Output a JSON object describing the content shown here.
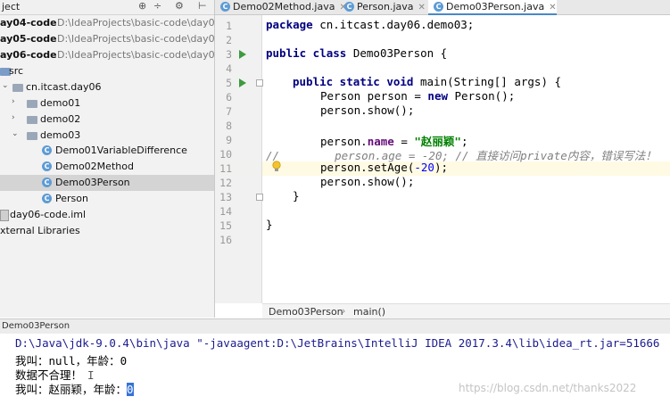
{
  "project": {
    "header_title": "ject",
    "icons": [
      "target-icon",
      "split-icon",
      "gear-icon",
      "hide-icon"
    ],
    "modules": [
      {
        "name": "ay04-code",
        "path": "D:\\IdeaProjects\\basic-code\\day04-cc"
      },
      {
        "name": "ay05-code",
        "path": "D:\\IdeaProjects\\basic-code\\day05-cc"
      },
      {
        "name": "ay06-code",
        "path": "D:\\IdeaProjects\\basic-code\\day06-cc"
      }
    ],
    "tree": {
      "src": "src",
      "package": "cn.itcast.day06",
      "demo01": "demo01",
      "demo02": "demo02",
      "demo03": "demo03",
      "class1": "Demo01VariableDifference",
      "class2": "Demo02Method",
      "class3": "Demo03Person",
      "class4": "Person",
      "iml": "day06-code.iml",
      "ext": "xternal Libraries"
    }
  },
  "tabs": [
    {
      "label": "Demo02Method.java",
      "active": false
    },
    {
      "label": "Person.java",
      "active": false
    },
    {
      "label": "Demo03Person.java",
      "active": true
    }
  ],
  "editor": {
    "line_numbers": [
      "1",
      "2",
      "3",
      "4",
      "5",
      "6",
      "7",
      "8",
      "9",
      "10",
      "11",
      "12",
      "13",
      "14",
      "15",
      "16"
    ],
    "line1": {
      "kw": "package",
      "rest": " cn.itcast.day06.demo03;"
    },
    "line3": {
      "kw": "public class",
      "rest": " Demo03Person {"
    },
    "line5": {
      "kw": "public static void",
      "rest": " main(String[] args) {"
    },
    "line6": {
      "pre": "Person person = ",
      "kw": "new",
      "post": " Person();"
    },
    "line7": "person.show();",
    "line9": {
      "pre": "person.",
      "fld": "name",
      "mid": " = ",
      "str": "\"赵丽颖\"",
      "post": ";"
    },
    "line10": {
      "slash": "//",
      "body": "person.age = -20; // 直接访问private内容，错误写法！"
    },
    "line11": {
      "pre": "person.setAge(",
      "num": "-20",
      "post": ");"
    },
    "line12": "person.show();",
    "line13": "}",
    "line15": "}"
  },
  "breadcrumb": {
    "class": "Demo03Person",
    "sep": "›",
    "method": "main()"
  },
  "run": {
    "tab_label": "Demo03Person",
    "cmd": "D:\\Java\\jdk-9.0.4\\bin\\java \"-javaagent:D:\\JetBrains\\IntelliJ IDEA 2017.3.4\\lib\\idea_rt.jar=51666",
    "out1": "我叫：null，年龄：0",
    "out2": "数据不合理！",
    "out3_pre": "我叫：赵丽颖，年龄：",
    "out3_sel": "0"
  },
  "watermark": "https://blog.csdn.net/thanks2022"
}
